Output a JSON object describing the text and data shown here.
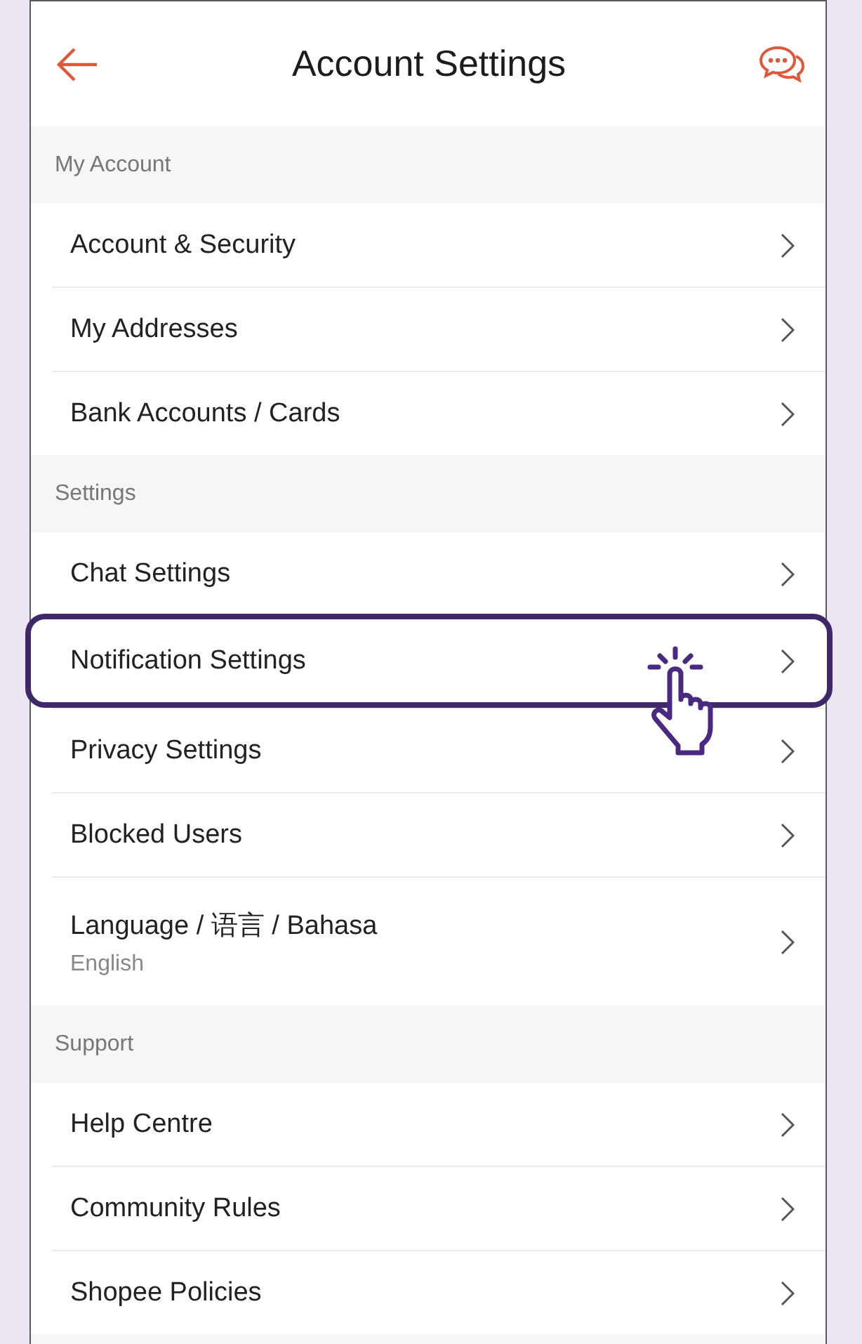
{
  "header": {
    "title": "Account Settings"
  },
  "sections": [
    {
      "heading": "My Account",
      "items": [
        {
          "label": "Account & Security",
          "selected": false
        },
        {
          "label": "My Addresses",
          "selected": false
        },
        {
          "label": "Bank Accounts / Cards",
          "selected": false
        }
      ]
    },
    {
      "heading": "Settings",
      "items": [
        {
          "label": "Chat Settings",
          "selected": false
        },
        {
          "label": "Notification Settings",
          "selected": true
        },
        {
          "label": "Privacy Settings",
          "selected": false
        },
        {
          "label": "Blocked Users",
          "selected": false
        },
        {
          "label": "Language / 语言 / Bahasa",
          "sublabel": "English",
          "selected": false
        }
      ]
    },
    {
      "heading": "Support",
      "items": [
        {
          "label": "Help Centre",
          "selected": false
        },
        {
          "label": "Community Rules",
          "selected": false
        },
        {
          "label": "Shopee Policies",
          "selected": false
        }
      ]
    }
  ]
}
